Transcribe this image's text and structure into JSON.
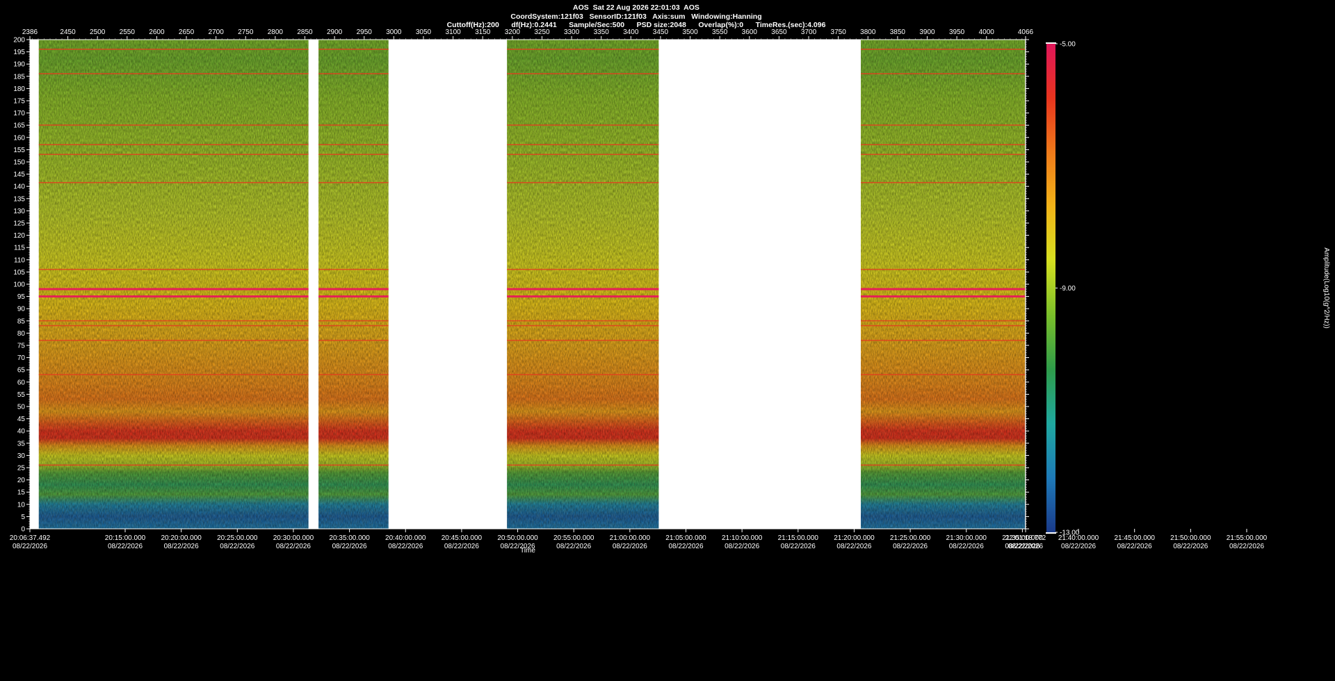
{
  "header": {
    "line1": "AOS  Sat 22 Aug 2026 22:01:03  AOS",
    "line2": "CoordSystem:121f03   SensorID:121f03   Axis:sum   Windowing:Hanning",
    "line3": "Cuttoff(Hz):200      df(Hz):0.2441      Sample/Sec:500      PSD size:2048      Overlap(%):0      TimeRes.(sec):4.096"
  },
  "chart_data": {
    "type": "heatmap",
    "title": "AOS  Sat 22 Aug 2026 22:01:03  AOS",
    "xlabel": "Time",
    "ylabel": "",
    "ylim": [
      0,
      200
    ],
    "xlim_top": [
      2386,
      4066
    ],
    "top_ticks": [
      "2386",
      "2450",
      "2500",
      "2550",
      "2600",
      "2650",
      "2700",
      "2750",
      "2800",
      "2850",
      "2900",
      "2950",
      "3000",
      "3050",
      "3100",
      "3150",
      "3200",
      "3250",
      "3300",
      "3350",
      "3400",
      "3450",
      "3500",
      "3550",
      "3600",
      "3650",
      "3700",
      "3750",
      "3800",
      "3850",
      "3900",
      "3950",
      "4000",
      "4066"
    ],
    "y_ticks": [
      "200",
      "195",
      "190",
      "185",
      "180",
      "175",
      "170",
      "165",
      "160",
      "155",
      "150",
      "145",
      "140",
      "135",
      "130",
      "125",
      "120",
      "115",
      "110",
      "105",
      "100",
      "95",
      "90",
      "85",
      "80",
      "75",
      "70",
      "65",
      "60",
      "55",
      "50",
      "45",
      "40",
      "35",
      "30",
      "25",
      "20",
      "15",
      "10",
      "5",
      "0"
    ],
    "time_ticks": [
      {
        "time": "20:06:37.492",
        "date": "08/22/2026"
      },
      {
        "time": "20:15:00.000",
        "date": "08/22/2026"
      },
      {
        "time": "20:20:00.000",
        "date": "08/22/2026"
      },
      {
        "time": "20:25:00.000",
        "date": "08/22/2026"
      },
      {
        "time": "20:30:00.000",
        "date": "08/22/2026"
      },
      {
        "time": "20:35:00.000",
        "date": "08/22/2026"
      },
      {
        "time": "20:40:00.000",
        "date": "08/22/2026"
      },
      {
        "time": "20:45:00.000",
        "date": "08/22/2026"
      },
      {
        "time": "20:50:00.000",
        "date": "08/22/2026"
      },
      {
        "time": "20:55:00.000",
        "date": "08/22/2026"
      },
      {
        "time": "21:00:00.000",
        "date": "08/22/2026"
      },
      {
        "time": "21:05:00.000",
        "date": "08/22/2026"
      },
      {
        "time": "21:10:00.000",
        "date": "08/22/2026"
      },
      {
        "time": "21:15:00.000",
        "date": "08/22/2026"
      },
      {
        "time": "21:20:00.000",
        "date": "08/22/2026"
      },
      {
        "time": "21:25:00.000",
        "date": "08/22/2026"
      },
      {
        "time": "21:30:00.000",
        "date": "08/22/2026"
      },
      {
        "time": "21:35:00.000",
        "date": "08/22/2026"
      },
      {
        "time": "21:40:00.000",
        "date": "08/22/2026"
      },
      {
        "time": "21:45:00.000",
        "date": "08/22/2026"
      },
      {
        "time": "21:50:00.000",
        "date": "08/22/2026"
      },
      {
        "time": "21:55:00.000",
        "date": "08/22/2026"
      },
      {
        "time": "22:01:18.772",
        "date": "08/22/2026"
      }
    ],
    "data_segments_x": [
      [
        2401,
        2856
      ],
      [
        2873,
        2991
      ],
      [
        3191,
        3447
      ],
      [
        3788,
        4065
      ]
    ],
    "frequency_bands_hz": {
      "dominant_band": [
        36,
        42
      ],
      "strong_band": [
        50,
        65
      ],
      "low_energy_band": [
        0,
        15
      ]
    },
    "tonal_lines_hz": [
      196,
      186,
      165,
      157,
      153,
      141.5,
      106,
      98,
      95,
      85,
      83,
      77,
      63,
      26
    ],
    "colorbar": {
      "label": "Amplitude(Log10(g^2/Hz))",
      "max_label": "-5.00",
      "mid_label": "-9.00",
      "min_label": "-13.00",
      "range": [
        -13,
        -5
      ],
      "colors": [
        "#1a3a8a",
        "#1e7ab8",
        "#1fa8a0",
        "#2e9c4a",
        "#7abf2a",
        "#d6e020",
        "#f2b418",
        "#ef7a1a",
        "#e8341e",
        "#e0165a"
      ]
    },
    "grid": false
  }
}
